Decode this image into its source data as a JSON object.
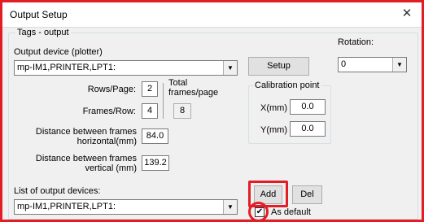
{
  "window": {
    "title": "Output Setup",
    "close_glyph": "✕"
  },
  "tags_group": {
    "title": "Tags - output"
  },
  "output_device": {
    "label": "Output device (plotter)",
    "value": "mp-IM1,PRINTER,LPT1:"
  },
  "setup_button": "Setup",
  "rotation": {
    "label": "Rotation:",
    "value": "0"
  },
  "rows_per_page": {
    "label": "Rows/Page:",
    "value": "2"
  },
  "frames_per_row": {
    "label": "Frames/Row:",
    "value": "4"
  },
  "total": {
    "label_line1": "Total",
    "label_line2": "frames/page",
    "value": "8"
  },
  "calibration": {
    "title": "Calibration point",
    "x_label": "X(mm)",
    "x_value": "0.0",
    "y_label": "Y(mm)",
    "y_value": "0.0"
  },
  "distance_horizontal": {
    "label_line1": "Distance between frames",
    "label_line2": "horizontal(mm)",
    "value": "84.0"
  },
  "distance_vertical": {
    "label_line1": "Distance between frames",
    "label_line2": "vertical (mm)",
    "value": "139.2"
  },
  "device_list": {
    "label": "List of output devices:",
    "value": "mp-IM1,PRINTER,LPT1:"
  },
  "add_button": "Add",
  "del_button": "Del",
  "as_default": {
    "label": "As default",
    "checked": true,
    "check_glyph": "✔"
  },
  "colors": {
    "highlight": "#e31d25",
    "window_bg": "#f0f0f0",
    "button_bg": "#e1e1e1"
  }
}
